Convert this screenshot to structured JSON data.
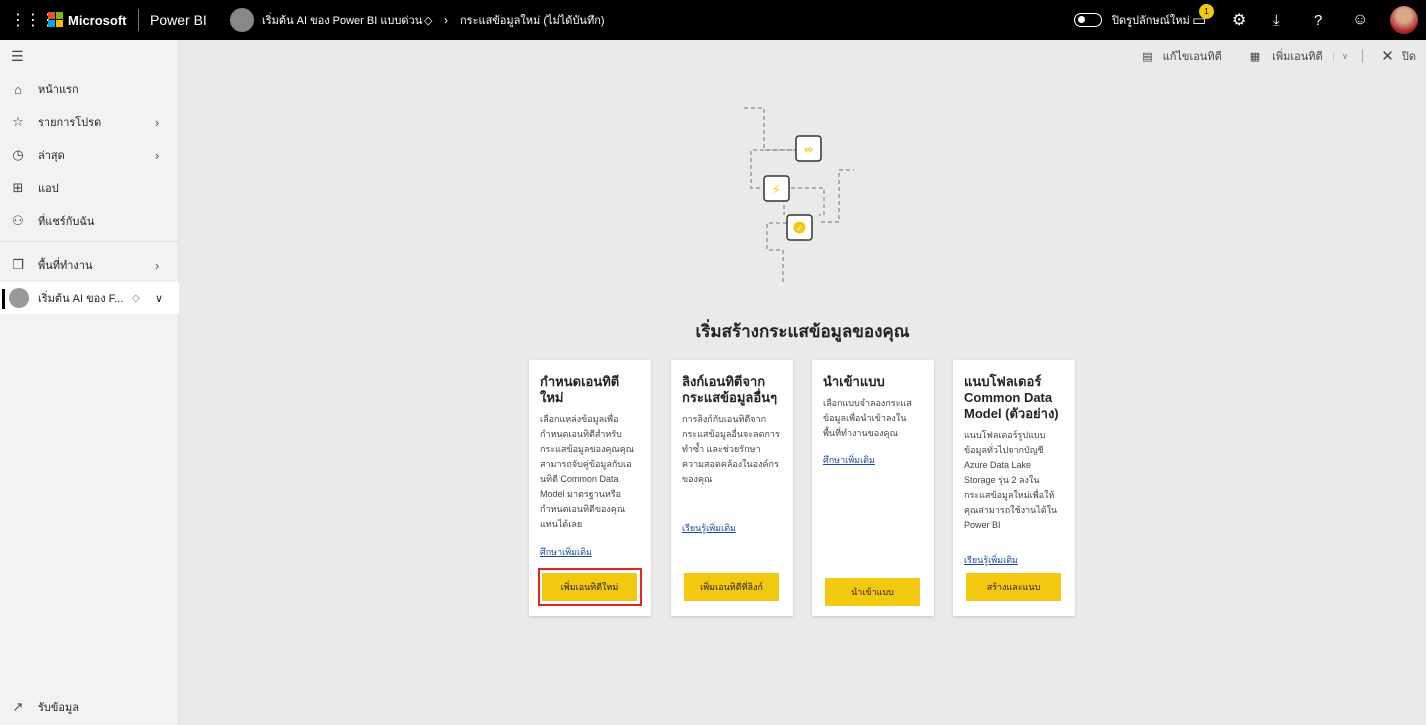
{
  "topbar": {
    "brand": "Microsoft",
    "product": "Power BI",
    "workspace": "เริ่มต้น AI ของ Power BI แบบด่วน",
    "page": "กระแสข้อมูลใหม่ (ไม่ได้บันทึก)",
    "toggle_label": "ปิดรูปลักษณ์ใหม่",
    "notification_count": "1"
  },
  "toolbar": {
    "edit": "แก้ไขเอนทิตี",
    "add": "เพิ่มเอนทิตี",
    "close": "ปิด"
  },
  "sidebar": {
    "items": [
      {
        "label": "หน้าแรก",
        "icon": "home-icon"
      },
      {
        "label": "รายการโปรด",
        "icon": "star-icon"
      },
      {
        "label": "ล่าสุด",
        "icon": "clock-icon"
      },
      {
        "label": "แอป",
        "icon": "apps-icon"
      },
      {
        "label": "ที่แชร์กับฉัน",
        "icon": "shared-icon"
      },
      {
        "label": "พื้นที่ทำงาน",
        "icon": "workspaces-icon"
      }
    ],
    "current_workspace": "เริ่มต้น AI ของ F...",
    "get_data": "รับข้อมูล"
  },
  "main": {
    "title": "เริ่มสร้างกระแสข้อมูลของคุณ",
    "cards": [
      {
        "title": "กำหนดเอนทิตีใหม่",
        "body": "เลือกแหล่งข้อมูลเพื่อกำหนดเอนทิตีสำหรับกระแสข้อมูลของคุณคุณสามารถจับคู่ข้อมูลกับเอนทิตี Common Data Model มาตรฐานหรือกำหนดเอนทิตีของคุณแทนได้เลย",
        "link": "ศึกษาเพิ่มเติม",
        "button": "เพิ่มเอนทิตีใหม่"
      },
      {
        "title": "ลิงก์เอนทิตีจากกระแสข้อมูลอื่นๆ",
        "body": "การลิงก์กับเอนทิตีจากกระแสข้อมูลอื่นจะลดการทำซ้ำ และช่วยรักษาความสอดคล้องในองค์กรของคุณ",
        "link": "เรียนรู้เพิ่มเติม",
        "button": "เพิ่มเอนทิตีที่ลิงก์"
      },
      {
        "title": "นำเข้าแบบ",
        "body": "เลือกแบบจำลองกระแสข้อมูลเพื่อนำเข้าลงในพื้นที่ทำงานของคุณ",
        "link": "ศึกษาเพิ่มเติม",
        "button": "นำเข้าแบบ"
      },
      {
        "title": "แนบโฟลเดอร์ Common Data Model (ตัวอย่าง)",
        "body": "แนบโฟลเดอร์รูปแบบข้อมูลทั่วไปจากบัญชี Azure Data Lake Storage รุ่น 2 ลงในกระแสข้อมูลใหม่เพื่อให้คุณสามารถใช้งานได้ใน Power BI",
        "link": "เรียนรู้เพิ่มเติม",
        "button": "สร้างและแนบ"
      }
    ]
  },
  "colors": {
    "accent": "#f2c811",
    "highlight": "#e3242b",
    "link": "#1a4a9c"
  }
}
